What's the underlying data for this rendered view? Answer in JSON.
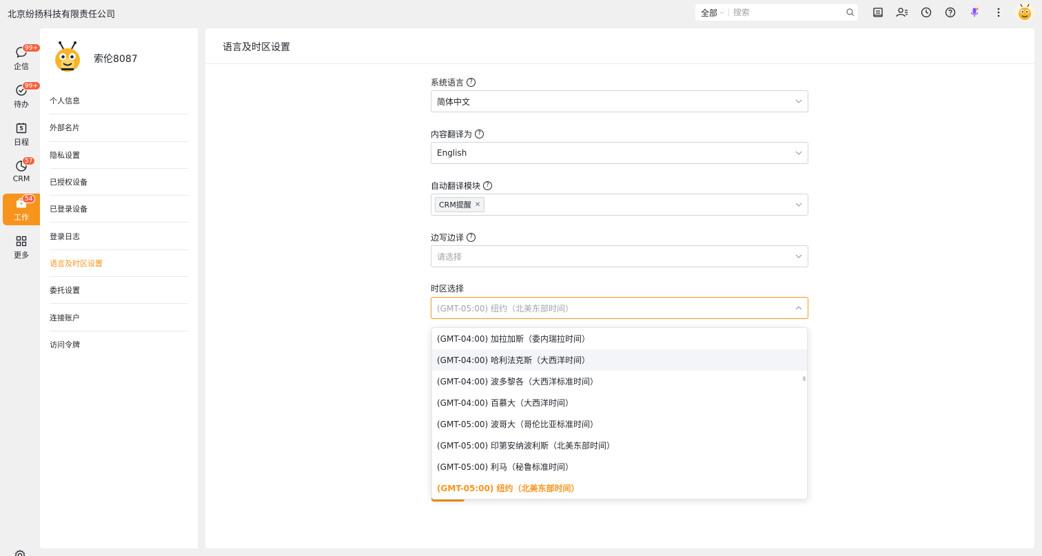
{
  "app": {
    "company": "北京纷扬科技有限责任公司"
  },
  "search": {
    "scope": "全部",
    "placeholder": "搜索"
  },
  "rail": {
    "items": [
      {
        "label": "企信",
        "badge": "99+",
        "icon": "chat-bubble-icon"
      },
      {
        "label": "待办",
        "badge": "99+",
        "icon": "check-circle-icon"
      },
      {
        "label": "日程",
        "badge": "",
        "icon": "calendar-icon",
        "calendar_day": "5"
      },
      {
        "label": "CRM",
        "badge": "57",
        "icon": "crm-icon"
      },
      {
        "label": "工作",
        "badge": "54",
        "icon": "briefcase-icon",
        "active": true
      },
      {
        "label": "更多",
        "badge": "",
        "icon": "grid-icon"
      }
    ]
  },
  "profile": {
    "name": "索伦8087"
  },
  "menu": {
    "items": [
      "个人信息",
      "外部名片",
      "隐私设置",
      "已授权设备",
      "已登录设备",
      "登录日志",
      "语言及时区设置",
      "委托设置",
      "连接账户",
      "访问令牌"
    ],
    "active_index": 6
  },
  "main": {
    "title": "语言及时区设置",
    "fields": {
      "system_language": {
        "label": "系统语言",
        "value": "简体中文"
      },
      "translate_to": {
        "label": "内容翻译为",
        "value": "English"
      },
      "auto_translate": {
        "label": "自动翻译模块",
        "tag": "CRM提醒"
      },
      "side_translate": {
        "label": "边写边译",
        "placeholder": "请选择"
      },
      "timezone": {
        "label": "时区选择",
        "value": "(GMT-05:00) 纽约（北美东部时间）"
      }
    }
  },
  "timezone_options": [
    "(GMT-04:00) 加拉加斯（委内瑞拉时间）",
    "(GMT-04:00) 哈利法克斯（大西洋时间）",
    "(GMT-04:00) 波多黎各（大西洋标准时间）",
    "(GMT-04:00) 百慕大（大西洋时间）",
    "(GMT-05:00) 波哥大（哥伦比亚标准时间）",
    "(GMT-05:00) 印第安纳波利斯（北美东部时间）",
    "(GMT-05:00) 利马（秘鲁标准时间）",
    "(GMT-05:00) 纽约（北美东部时间）"
  ],
  "timezone_hover_index": 1,
  "timezone_selected_index": 7,
  "colors": {
    "accent": "#f7941d",
    "badge": "#f5613f",
    "background": "#f0f0f1"
  }
}
